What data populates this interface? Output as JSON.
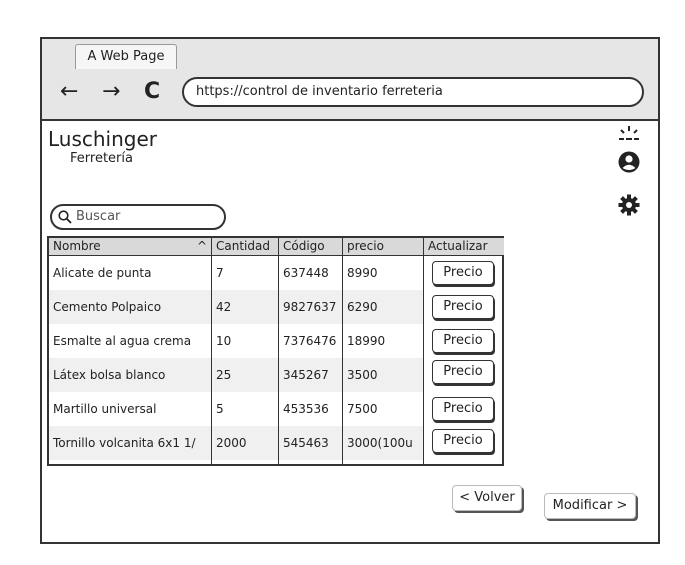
{
  "browser": {
    "tab_title": "A Web Page",
    "url": "https://control de inventario ferreteria",
    "back_glyph": "←",
    "forward_glyph": "→",
    "reload_glyph": "C"
  },
  "header": {
    "brand": "Luschinger",
    "subtitle": "Ferretería"
  },
  "icons": {
    "notification": "notification-icon",
    "user": "user-icon",
    "settings": "gear-icon",
    "search": "search-icon"
  },
  "search": {
    "placeholder": "Buscar"
  },
  "table": {
    "columns": [
      "Nombre",
      "Cantidad",
      "Código",
      "precio",
      "Actualizar"
    ],
    "sort_glyph": "^",
    "rows": [
      {
        "nombre": "Alicate de punta",
        "cantidad": "7",
        "codigo": "637448",
        "precio": "8990",
        "accion": "Precio"
      },
      {
        "nombre": "Cemento Polpaico",
        "cantidad": "42",
        "codigo": "9827637",
        "precio": "6290",
        "accion": "Precio"
      },
      {
        "nombre": "Esmalte al agua crema",
        "cantidad": "10",
        "codigo": "7376476",
        "precio": "18990",
        "accion": "Precio"
      },
      {
        "nombre": "Látex bolsa blanco",
        "cantidad": "25",
        "codigo": "345267",
        "precio": "3500",
        "accion": "Precio"
      },
      {
        "nombre": "Martillo universal",
        "cantidad": "5",
        "codigo": "453536",
        "precio": "7500",
        "accion": "Precio"
      },
      {
        "nombre": "Tornillo volcanita 6x1 1/",
        "cantidad": "2000",
        "codigo": "545463",
        "precio": "3000(100u",
        "accion": "Precio"
      }
    ]
  },
  "footer": {
    "back_label": "< Volver",
    "modify_label": "Modificar >"
  }
}
